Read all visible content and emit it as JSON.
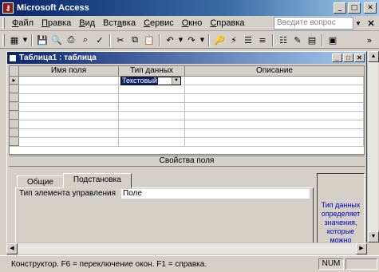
{
  "app": {
    "title": "Microsoft Access",
    "icon": "access-key-icon"
  },
  "menu": {
    "items": [
      {
        "pre": "",
        "u": "Ф",
        "post": "айл"
      },
      {
        "pre": "",
        "u": "П",
        "post": "равка"
      },
      {
        "pre": "",
        "u": "В",
        "post": "ид"
      },
      {
        "pre": "Вст",
        "u": "а",
        "post": "вка"
      },
      {
        "pre": "",
        "u": "С",
        "post": "ервис"
      },
      {
        "pre": "",
        "u": "О",
        "post": "кно"
      },
      {
        "pre": "",
        "u": "С",
        "post": "правка"
      }
    ],
    "help_placeholder": "Введите вопрос"
  },
  "document": {
    "title": "Таблица1 : таблица"
  },
  "grid": {
    "headers": [
      "Имя поля",
      "Тип данных",
      "Описание"
    ],
    "type_value": "Текстовый"
  },
  "props": {
    "bar_label": "Свойства поля",
    "tabs": [
      "Общие",
      "Подстановка"
    ],
    "row_label": "Тип элемента управления",
    "row_value": "Поле"
  },
  "hint": {
    "text": "Тип данных определяет значения, которые можно"
  },
  "status": {
    "text": "Конструктор. F6 = переключение окон. F1 = справка.",
    "num": "NUM"
  }
}
